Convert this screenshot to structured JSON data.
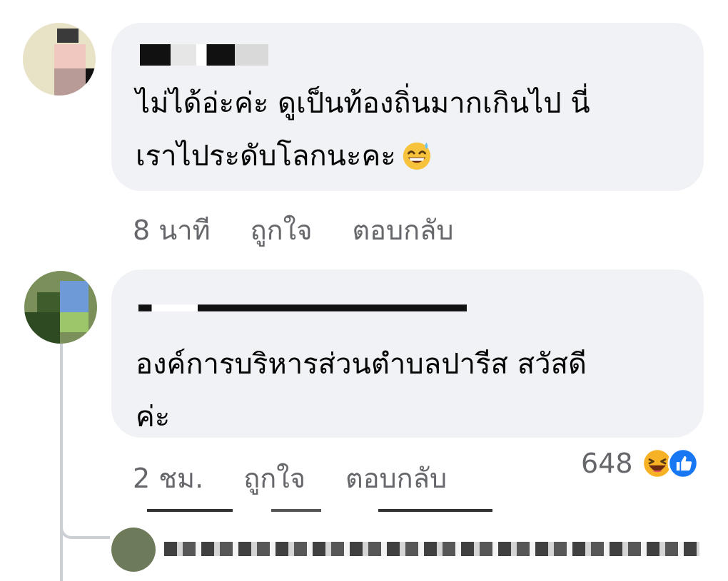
{
  "comments": [
    {
      "text": "ไม่ได้อ่ะค่ะ ดูเป็นท้องถิ่นมากเกินไป นี่\nเราไประดับโลกนะคะ",
      "emoji": "grinning-sweat-icon",
      "time": "8 นาที",
      "like_label": "ถูกใจ",
      "reply_label": "ตอบกลับ"
    },
    {
      "text": "องค์การบริหารส่วนตำบลปารีส สวัสดี\nค่ะ",
      "time": "2 ชม.",
      "like_label": "ถูกใจ",
      "reply_label": "ตอบกลับ",
      "reactions": {
        "count": "648",
        "icons": [
          "laugh-reaction-icon",
          "like-reaction-icon"
        ]
      }
    }
  ],
  "colors": {
    "bubble": "#f0f2f5",
    "meta_text": "#65676b",
    "like_blue": "#1877f2",
    "laugh_yellow": "#f7b125"
  }
}
